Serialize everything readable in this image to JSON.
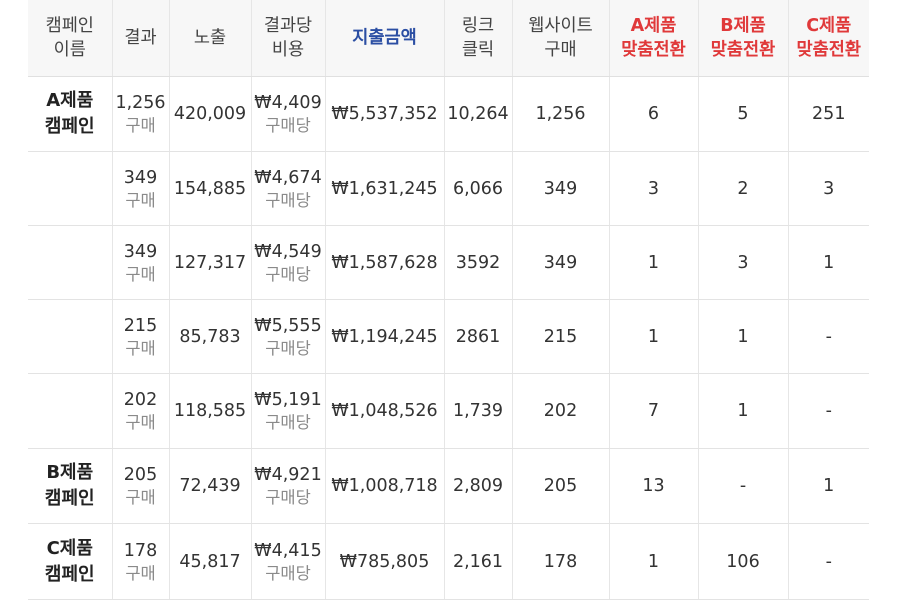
{
  "header": [
    "캠페인\n이름",
    "결과",
    "노출",
    "결과당\n비용",
    "지출금액",
    "링크\n클릭",
    "웹사이트\n구매",
    "A제품\n맞춤전환",
    "B제품\n맞춤전환",
    "C제품\n맞춤전환"
  ],
  "header_colors": {
    "spend": "#2b4ea3",
    "conversion": "#e0393a"
  },
  "result_unit": "구매",
  "cost_unit": "구매당",
  "rows": [
    {
      "name": "A제품\n캠페인",
      "result": "1,256",
      "impressions": "420,009",
      "cost": "₩4,409",
      "spend": "₩5,537,352",
      "clicks": "10,264",
      "purchases": "1,256",
      "a_conv": "6",
      "b_conv": "5",
      "c_conv": "251"
    },
    {
      "name": "",
      "result": "349",
      "impressions": "154,885",
      "cost": "₩4,674",
      "spend": "₩1,631,245",
      "clicks": "6,066",
      "purchases": "349",
      "a_conv": "3",
      "b_conv": "2",
      "c_conv": "3"
    },
    {
      "name": "",
      "result": "349",
      "impressions": "127,317",
      "cost": "₩4,549",
      "spend": "₩1,587,628",
      "clicks": "3592",
      "purchases": "349",
      "a_conv": "1",
      "b_conv": "3",
      "c_conv": "1"
    },
    {
      "name": "",
      "result": "215",
      "impressions": "85,783",
      "cost": "₩5,555",
      "spend": "₩1,194,245",
      "clicks": "2861",
      "purchases": "215",
      "a_conv": "1",
      "b_conv": "1",
      "c_conv": "-"
    },
    {
      "name": "",
      "result": "202",
      "impressions": "118,585",
      "cost": "₩5,191",
      "spend": "₩1,048,526",
      "clicks": "1,739",
      "purchases": "202",
      "a_conv": "7",
      "b_conv": "1",
      "c_conv": "-"
    },
    {
      "name": "B제품\n캠페인",
      "result": "205",
      "impressions": "72,439",
      "cost": "₩4,921",
      "spend": "₩1,008,718",
      "clicks": "2,809",
      "purchases": "205",
      "a_conv": "13",
      "b_conv": "-",
      "c_conv": "1"
    },
    {
      "name": "C제품\n캠페인",
      "result": "178",
      "impressions": "45,817",
      "cost": "₩4,415",
      "spend": "₩785,805",
      "clicks": "2,161",
      "purchases": "178",
      "a_conv": "1",
      "b_conv": "106",
      "c_conv": "-"
    }
  ]
}
